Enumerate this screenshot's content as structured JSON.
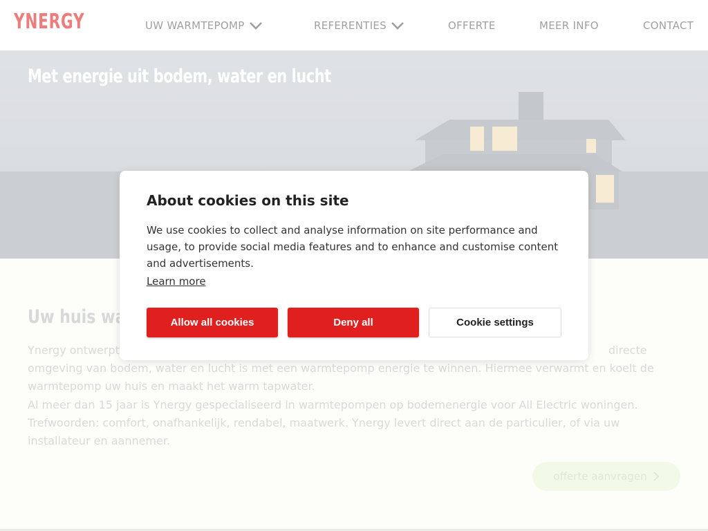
{
  "brand": {
    "logo_text": "YNERGY",
    "accent_color": "#e0201f"
  },
  "nav": {
    "items": [
      {
        "label": "UW WARMTEPOMP",
        "has_dropdown": true
      },
      {
        "label": "REFERENTIES",
        "has_dropdown": true
      },
      {
        "label": "OFFERTE",
        "has_dropdown": false
      },
      {
        "label": "MEER INFO",
        "has_dropdown": false
      },
      {
        "label": "CONTACT",
        "has_dropdown": false
      }
    ]
  },
  "hero": {
    "title": "Met energie uit bodem, water en lucht"
  },
  "main": {
    "heading": "Uw huis warm",
    "paragraph_lines": [
      "Ynergy ontwerpt",
      "directe",
      "omgeving van bodem, water en lucht is met een warmtepomp energie te winnen. Hiermee verwarmt en koelt de",
      "warmtepomp uw huis en maakt het warm tapwater.",
      "Al meer dan 15 jaar is Ynergy gespecialiseerd in warmtepompen op bodemenergie voor All Electric woningen.",
      "Trefwoorden: comfort, onafhankelijk, rendabel, maatwerk. Ynergy levert direct aan de particulier, of via uw",
      "installateur en aannemer."
    ],
    "cta_label": "offerte aanvragen"
  },
  "cookie_modal": {
    "title": "About cookies on this site",
    "body": "We use cookies to collect and analyse information on site performance and usage, to provide social media features and to enhance and customise content and advertisements.",
    "learn_more": "Learn more",
    "allow_label": "Allow all cookies",
    "deny_label": "Deny all",
    "settings_label": "Cookie settings"
  },
  "icons": {
    "dropdown": "chevron-down-icon",
    "cta_arrow": "chevron-right-icon"
  }
}
